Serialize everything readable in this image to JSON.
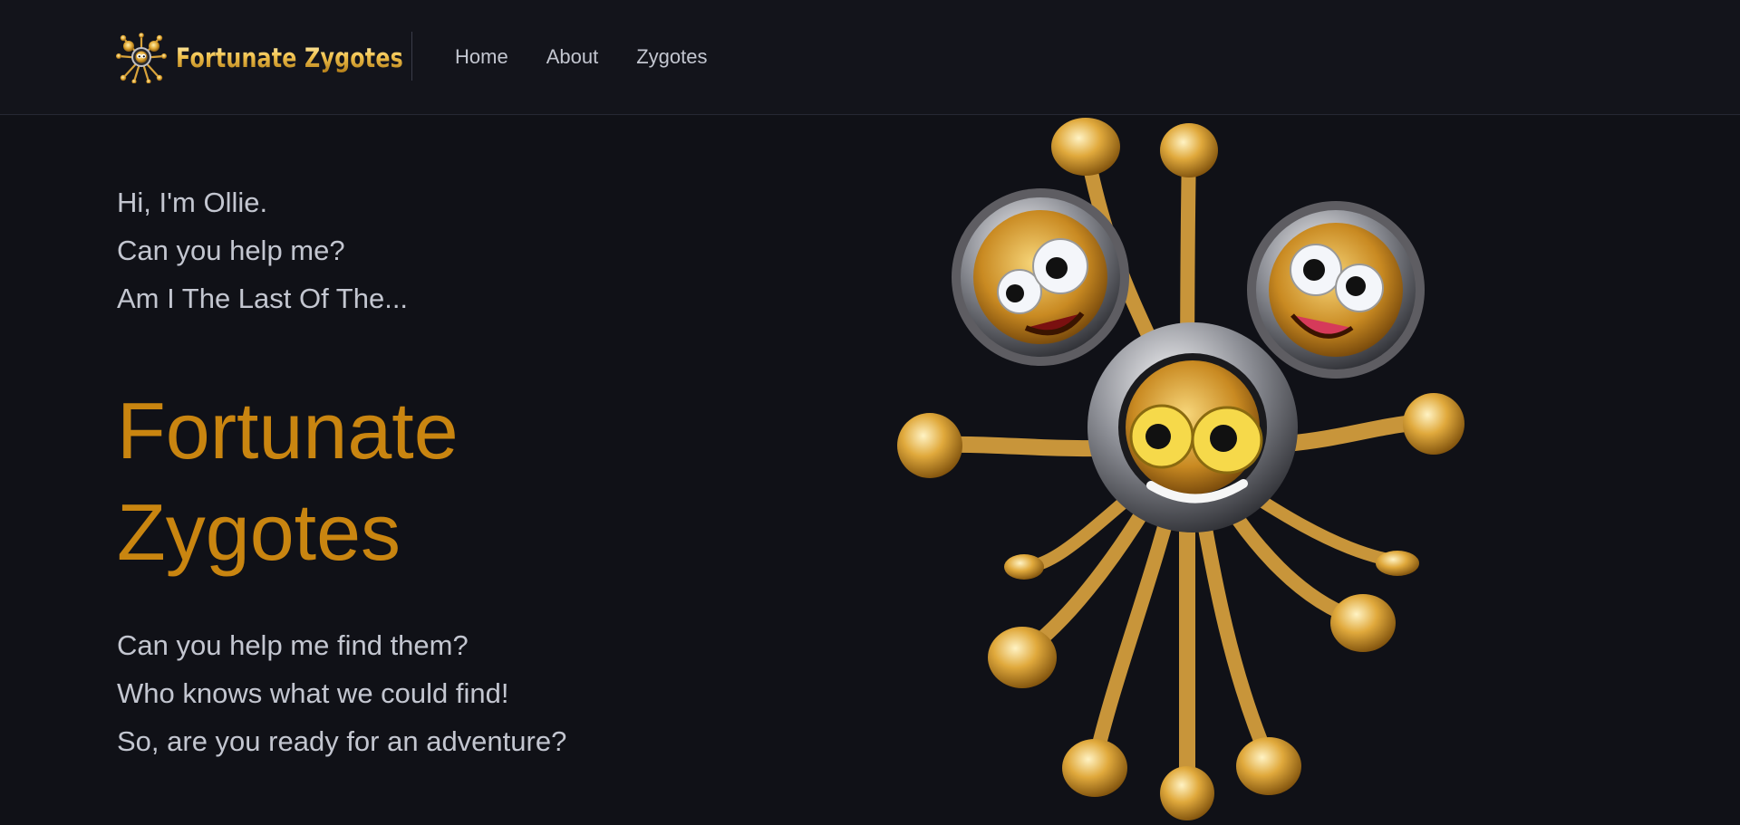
{
  "header": {
    "brand_name": "Fortunate Zygotes",
    "logo_icon": "zygote-logo-icon",
    "nav": [
      {
        "label": "Home"
      },
      {
        "label": "About"
      },
      {
        "label": "Zygotes"
      }
    ]
  },
  "hero": {
    "intro": [
      "Hi, I'm Ollie.",
      "Can you help me?",
      "Am I The Last Of The..."
    ],
    "title_line1": "Fortunate",
    "title_line2": "Zygotes",
    "outro": [
      "Can you help me find them?",
      "Who knows what we could find!",
      "So, are you ready for an adventure?"
    ]
  },
  "image": {
    "subject": "ollie-mascot-illustration"
  },
  "colors": {
    "background": "#101117",
    "header_bg": "#13141b",
    "accent": "#c98510",
    "text": "#c3c6d0",
    "gold": "#e9b84a"
  }
}
